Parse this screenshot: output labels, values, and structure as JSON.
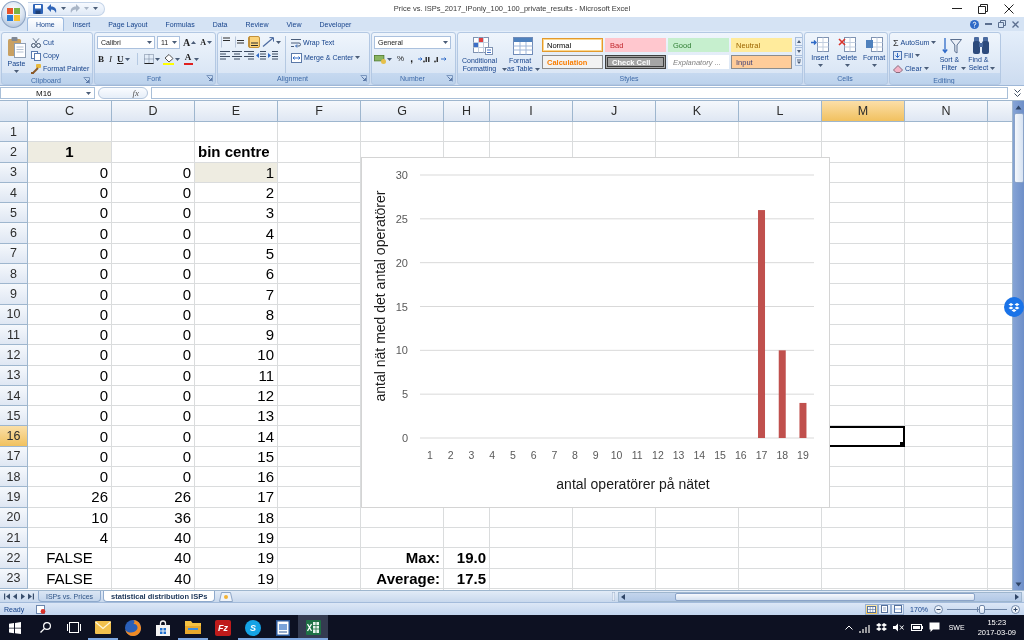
{
  "title_bar": {
    "title": "Price vs. ISPs_2017_IPonly_100_100_private_results - Microsoft Excel",
    "quick_access": [
      {
        "kind": "save",
        "disabled": false
      },
      {
        "kind": "undo",
        "disabled": false
      },
      {
        "kind": "redo",
        "disabled": true
      }
    ]
  },
  "ribbon_tabs": [
    {
      "label": "Home",
      "selected": true
    },
    {
      "label": "Insert",
      "selected": false
    },
    {
      "label": "Page Layout",
      "selected": false
    },
    {
      "label": "Formulas",
      "selected": false
    },
    {
      "label": "Data",
      "selected": false
    },
    {
      "label": "Review",
      "selected": false
    },
    {
      "label": "View",
      "selected": false
    },
    {
      "label": "Developer",
      "selected": false
    }
  ],
  "ribbon": {
    "clipboard": {
      "label": "Clipboard",
      "paste": "Paste",
      "small_buttons": [
        {
          "kind": "cut",
          "label": "Cut"
        },
        {
          "kind": "copy",
          "label": "Copy"
        },
        {
          "kind": "format-painter",
          "label": "Format Painter"
        }
      ]
    },
    "font": {
      "label": "Font",
      "font_name": "Calibri",
      "font_size": "11",
      "size_buttons": [
        {
          "kind": "grow",
          "label": "A"
        },
        {
          "kind": "shrink",
          "label": "A"
        }
      ],
      "style_buttons": [
        {
          "kind": "bold",
          "label": "B"
        },
        {
          "kind": "italic",
          "label": "I"
        },
        {
          "kind": "underline",
          "label": "U"
        }
      ],
      "font_color_label": "A"
    },
    "alignment": {
      "label": "Alignment",
      "vertical": [
        {
          "kind": "top",
          "selected": false
        },
        {
          "kind": "middle",
          "selected": false
        },
        {
          "kind": "bottom",
          "selected": true
        }
      ],
      "wrap_text": "Wrap Text",
      "merge": "Merge & Center"
    },
    "number": {
      "label": "Number",
      "format": "General",
      "percent": "%",
      "comma": ","
    },
    "styles": {
      "label": "Styles",
      "conditional_formatting": "Conditional Formatting",
      "format_as_table": "Format as Table",
      "cell_styles": [
        {
          "kind": "normal",
          "label": "Normal",
          "selected": true
        },
        {
          "kind": "bad",
          "label": "Bad",
          "selected": false
        },
        {
          "kind": "good",
          "label": "Good",
          "selected": false
        },
        {
          "kind": "neutral",
          "label": "Neutral",
          "selected": false
        },
        {
          "kind": "calculation",
          "label": "Calculation",
          "selected": false
        },
        {
          "kind": "check",
          "label": "Check Cell",
          "selected": false
        },
        {
          "kind": "explanatory",
          "label": "Explanatory ...",
          "selected": false
        },
        {
          "kind": "input",
          "label": "Input",
          "selected": false
        }
      ]
    },
    "cells": {
      "label": "Cells",
      "buttons": [
        {
          "kind": "insert",
          "label": "Insert"
        },
        {
          "kind": "delete",
          "label": "Delete"
        },
        {
          "kind": "format",
          "label": "Format"
        }
      ]
    },
    "editing": {
      "label": "Editing",
      "small_buttons": [
        {
          "kind": "autosum",
          "symbol": "Σ",
          "label": "AutoSum"
        },
        {
          "kind": "fill",
          "label": "Fill"
        },
        {
          "kind": "clear",
          "label": "Clear"
        }
      ],
      "big_buttons": [
        {
          "kind": "sort-filter",
          "label": "Sort & Filter"
        },
        {
          "kind": "find-select",
          "label": "Find & Select"
        }
      ]
    }
  },
  "formula_bar": {
    "name_box": "M16",
    "function_label": "fx"
  },
  "sheet": {
    "columns": [
      {
        "label": "C",
        "selected": false
      },
      {
        "label": "D",
        "selected": false
      },
      {
        "label": "E",
        "selected": false
      },
      {
        "label": "F",
        "selected": false
      },
      {
        "label": "G",
        "selected": false
      },
      {
        "label": "H",
        "selected": false
      },
      {
        "label": "I",
        "selected": false
      },
      {
        "label": "J",
        "selected": false
      },
      {
        "label": "K",
        "selected": false
      },
      {
        "label": "L",
        "selected": false
      },
      {
        "label": "M",
        "selected": true
      },
      {
        "label": "N",
        "selected": false
      }
    ],
    "rows": [
      {
        "header": "1",
        "selected": false
      },
      {
        "header": "2",
        "selected": false,
        "cells": {
          "c": {
            "text": "1",
            "kind": "key"
          },
          "e": {
            "text": "bin centre",
            "kind": "heading"
          }
        }
      },
      {
        "header": "3",
        "selected": false,
        "cells": {
          "c": {
            "text": "0",
            "kind": "value"
          },
          "d": {
            "text": "0",
            "kind": "value"
          },
          "e": {
            "text": "1",
            "kind": "marked"
          }
        }
      },
      {
        "header": "4",
        "selected": false,
        "cells": {
          "c": {
            "text": "0",
            "kind": "value"
          },
          "d": {
            "text": "0",
            "kind": "value"
          },
          "e": {
            "text": "2",
            "kind": "value"
          }
        }
      },
      {
        "header": "5",
        "selected": false,
        "cells": {
          "c": {
            "text": "0",
            "kind": "value"
          },
          "d": {
            "text": "0",
            "kind": "value"
          },
          "e": {
            "text": "3",
            "kind": "value"
          }
        }
      },
      {
        "header": "6",
        "selected": false,
        "cells": {
          "c": {
            "text": "0",
            "kind": "value"
          },
          "d": {
            "text": "0",
            "kind": "value"
          },
          "e": {
            "text": "4",
            "kind": "value"
          }
        }
      },
      {
        "header": "7",
        "selected": false,
        "cells": {
          "c": {
            "text": "0",
            "kind": "value"
          },
          "d": {
            "text": "0",
            "kind": "value"
          },
          "e": {
            "text": "5",
            "kind": "value"
          }
        }
      },
      {
        "header": "8",
        "selected": false,
        "cells": {
          "c": {
            "text": "0",
            "kind": "value"
          },
          "d": {
            "text": "0",
            "kind": "value"
          },
          "e": {
            "text": "6",
            "kind": "value"
          }
        }
      },
      {
        "header": "9",
        "selected": false,
        "cells": {
          "c": {
            "text": "0",
            "kind": "value"
          },
          "d": {
            "text": "0",
            "kind": "value"
          },
          "e": {
            "text": "7",
            "kind": "value"
          }
        }
      },
      {
        "header": "10",
        "selected": false,
        "cells": {
          "c": {
            "text": "0",
            "kind": "value"
          },
          "d": {
            "text": "0",
            "kind": "value"
          },
          "e": {
            "text": "8",
            "kind": "value"
          }
        }
      },
      {
        "header": "11",
        "selected": false,
        "cells": {
          "c": {
            "text": "0",
            "kind": "value"
          },
          "d": {
            "text": "0",
            "kind": "value"
          },
          "e": {
            "text": "9",
            "kind": "value"
          }
        }
      },
      {
        "header": "12",
        "selected": false,
        "cells": {
          "c": {
            "text": "0",
            "kind": "value"
          },
          "d": {
            "text": "0",
            "kind": "value"
          },
          "e": {
            "text": "10",
            "kind": "value"
          }
        }
      },
      {
        "header": "13",
        "selected": false,
        "cells": {
          "c": {
            "text": "0",
            "kind": "value"
          },
          "d": {
            "text": "0",
            "kind": "value"
          },
          "e": {
            "text": "11",
            "kind": "value"
          }
        }
      },
      {
        "header": "14",
        "selected": false,
        "cells": {
          "c": {
            "text": "0",
            "kind": "value"
          },
          "d": {
            "text": "0",
            "kind": "value"
          },
          "e": {
            "text": "12",
            "kind": "value"
          }
        }
      },
      {
        "header": "15",
        "selected": false,
        "cells": {
          "c": {
            "text": "0",
            "kind": "value"
          },
          "d": {
            "text": "0",
            "kind": "value"
          },
          "e": {
            "text": "13",
            "kind": "value"
          }
        }
      },
      {
        "header": "16",
        "selected": true,
        "cells": {
          "c": {
            "text": "0",
            "kind": "value"
          },
          "d": {
            "text": "0",
            "kind": "value"
          },
          "e": {
            "text": "14",
            "kind": "value"
          }
        }
      },
      {
        "header": "17",
        "selected": false,
        "cells": {
          "c": {
            "text": "0",
            "kind": "value"
          },
          "d": {
            "text": "0",
            "kind": "value"
          },
          "e": {
            "text": "15",
            "kind": "value"
          }
        }
      },
      {
        "header": "18",
        "selected": false,
        "cells": {
          "c": {
            "text": "0",
            "kind": "value"
          },
          "d": {
            "text": "0",
            "kind": "value"
          },
          "e": {
            "text": "16",
            "kind": "value"
          }
        }
      },
      {
        "header": "19",
        "selected": false,
        "cells": {
          "c": {
            "text": "26",
            "kind": "value"
          },
          "d": {
            "text": "26",
            "kind": "value"
          },
          "e": {
            "text": "17",
            "kind": "value"
          }
        }
      },
      {
        "header": "20",
        "selected": false,
        "cells": {
          "c": {
            "text": "10",
            "kind": "value"
          },
          "d": {
            "text": "36",
            "kind": "value"
          },
          "e": {
            "text": "18",
            "kind": "value"
          }
        }
      },
      {
        "header": "21",
        "selected": false,
        "cells": {
          "c": {
            "text": "4",
            "kind": "value"
          },
          "d": {
            "text": "40",
            "kind": "value"
          },
          "e": {
            "text": "19",
            "kind": "value"
          }
        }
      },
      {
        "header": "22",
        "selected": false,
        "cells": {
          "c": {
            "text": "FALSE",
            "kind": "flag"
          },
          "d": {
            "text": "40",
            "kind": "value"
          },
          "e": {
            "text": "19",
            "kind": "value"
          },
          "g": {
            "text": "Max:",
            "kind": "stat"
          },
          "h": {
            "text": "19.0",
            "kind": "stat"
          }
        }
      },
      {
        "header": "23",
        "selected": false,
        "cells": {
          "c": {
            "text": "FALSE",
            "kind": "flag"
          },
          "d": {
            "text": "40",
            "kind": "value"
          },
          "e": {
            "text": "19",
            "kind": "value"
          },
          "g": {
            "text": "Average:",
            "kind": "stat"
          },
          "h": {
            "text": "17.5",
            "kind": "stat"
          }
        }
      }
    ],
    "chart": {
      "chart_data": {
        "type": "bar",
        "grid": true,
        "xlabel": "antal operatörer på nätet",
        "ylabel": "antal nät med det antal operatörer",
        "categories": [
          "1",
          "2",
          "3",
          "4",
          "5",
          "6",
          "7",
          "8",
          "9",
          "10",
          "11",
          "12",
          "13",
          "14",
          "15",
          "16",
          "17",
          "18",
          "19"
        ],
        "values": [
          0,
          0,
          0,
          0,
          0,
          0,
          0,
          0,
          0,
          0,
          0,
          0,
          0,
          0,
          0,
          0,
          26,
          10,
          4
        ],
        "ylim": [
          0,
          30
        ],
        "yticks": [
          0,
          5,
          10,
          15,
          20,
          25,
          30
        ]
      }
    }
  },
  "sheet_tabs": [
    {
      "label": "ISPs vs. Prices",
      "selected": false
    },
    {
      "label": "statistical distribution ISPs",
      "selected": true
    }
  ],
  "status_bar": {
    "status": "Ready",
    "views": [
      {
        "kind": "normal",
        "selected": true
      },
      {
        "kind": "page-layout",
        "selected": false
      },
      {
        "kind": "page-break",
        "selected": false
      }
    ],
    "zoom": "170%",
    "zoom_slider": {
      "level": 0.58
    }
  },
  "taskbar": {
    "apps": [
      {
        "kind": "mail",
        "running": true,
        "active": false
      },
      {
        "kind": "browser",
        "running": false,
        "active": false
      },
      {
        "kind": "store",
        "running": false,
        "active": false
      },
      {
        "kind": "folder",
        "running": true,
        "active": false
      },
      {
        "kind": "ftp",
        "label": "Fz",
        "running": false,
        "active": false
      },
      {
        "kind": "chat",
        "label": "S",
        "running": true,
        "active": false
      },
      {
        "kind": "document",
        "running": true,
        "active": false
      },
      {
        "kind": "spreadsheet",
        "running": true,
        "active": true
      }
    ],
    "language": "SWE",
    "time": "15:23",
    "date": "2017-03-09"
  }
}
